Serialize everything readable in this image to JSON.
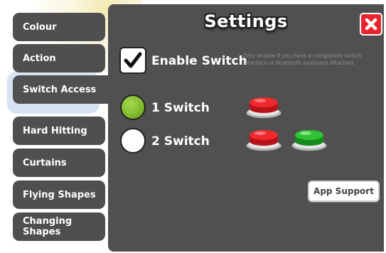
{
  "header": {
    "title": "Settings"
  },
  "sidebar": {
    "items": [
      {
        "label": "Colour"
      },
      {
        "label": "Action"
      },
      {
        "label": "Switch Access"
      },
      {
        "label": "Hard Hitting"
      },
      {
        "label": "Curtains"
      },
      {
        "label": "Flying Shapes"
      },
      {
        "label": "Changing Shapes"
      }
    ],
    "selected": "Switch Access"
  },
  "enable_switch": {
    "label": "Enable Switch",
    "checked": true,
    "note": "Only enable if you have a compatible switch interface or bluetooth keyboard attached."
  },
  "switch_modes": [
    {
      "label": "1 Switch",
      "selected": true,
      "buttons": [
        "red"
      ]
    },
    {
      "label": "2 Switch",
      "selected": false,
      "buttons": [
        "red",
        "green"
      ]
    }
  ],
  "footer": {
    "app_support_label": "App Support"
  },
  "icons": {
    "close": "close-icon",
    "check": "checkmark-icon"
  },
  "colors": {
    "close_bg": "#e8232b",
    "radio_on": "#7fb82b",
    "panel": "#505050",
    "red_button": "#e8232b",
    "green_button": "#2fb52f"
  }
}
